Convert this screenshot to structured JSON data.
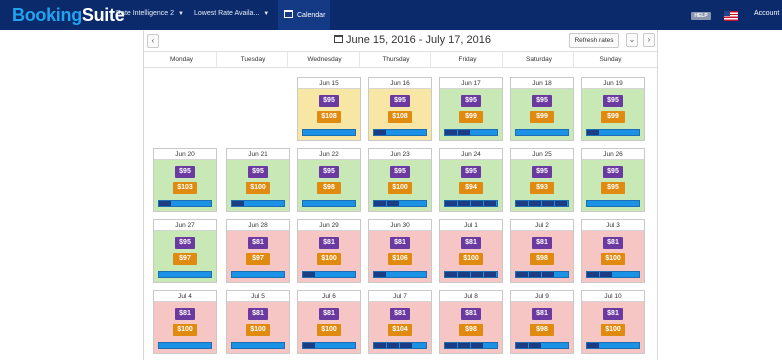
{
  "header": {
    "logo_part1": "Booking",
    "logo_part2": "Suite",
    "nav": [
      {
        "label": "Rate Intelligence 2"
      },
      {
        "label": "Lowest Rate Availa..."
      }
    ],
    "calendar_tab": "Calendar",
    "help": "HELP",
    "account": "Account"
  },
  "toolbar": {
    "prev": "‹",
    "next": "›",
    "range": "June 15, 2016 - July 17, 2016",
    "refresh": "Refresh rates",
    "dropdown": "⌄"
  },
  "weekdays": [
    "Monday",
    "Tuesday",
    "Wednesday",
    "Thursday",
    "Friday",
    "Saturday",
    "Sunday"
  ],
  "colors": {
    "yellow": "#f8e7a4",
    "green": "#c8e8b6",
    "red": "#f6c6c4",
    "purple": "#6a3aa0",
    "orange": "#e08a10",
    "bar": "#1c92e6"
  },
  "days": [
    {
      "date": "Jun 15",
      "rate": "$95",
      "compare": "$108",
      "status": "yellow",
      "level": 0
    },
    {
      "date": "Jun 16",
      "rate": "$95",
      "compare": "$108",
      "status": "yellow",
      "level": 1
    },
    {
      "date": "Jun 17",
      "rate": "$95",
      "compare": "$99",
      "status": "green",
      "level": 2
    },
    {
      "date": "Jun 18",
      "rate": "$95",
      "compare": "$99",
      "status": "green",
      "level": 0
    },
    {
      "date": "Jun 19",
      "rate": "$95",
      "compare": "$99",
      "status": "green",
      "level": 1
    },
    {
      "date": "Jun 20",
      "rate": "$95",
      "compare": "$103",
      "status": "green",
      "level": 1
    },
    {
      "date": "Jun 21",
      "rate": "$95",
      "compare": "$100",
      "status": "green",
      "level": 1
    },
    {
      "date": "Jun 22",
      "rate": "$95",
      "compare": "$98",
      "status": "green",
      "level": 0
    },
    {
      "date": "Jun 23",
      "rate": "$95",
      "compare": "$100",
      "status": "green",
      "level": 2
    },
    {
      "date": "Jun 24",
      "rate": "$95",
      "compare": "$94",
      "status": "green",
      "level": 4
    },
    {
      "date": "Jun 25",
      "rate": "$95",
      "compare": "$93",
      "status": "green",
      "level": 4
    },
    {
      "date": "Jun 26",
      "rate": "$95",
      "compare": "$95",
      "status": "green",
      "level": 0
    },
    {
      "date": "Jun 27",
      "rate": "$95",
      "compare": "$97",
      "status": "green",
      "level": 0
    },
    {
      "date": "Jun 28",
      "rate": "$81",
      "compare": "$97",
      "status": "red",
      "level": 0
    },
    {
      "date": "Jun 29",
      "rate": "$81",
      "compare": "$100",
      "status": "red",
      "level": 1
    },
    {
      "date": "Jun 30",
      "rate": "$81",
      "compare": "$106",
      "status": "red",
      "level": 1
    },
    {
      "date": "Jul 1",
      "rate": "$81",
      "compare": "$100",
      "status": "red",
      "level": 4
    },
    {
      "date": "Jul 2",
      "rate": "$81",
      "compare": "$98",
      "status": "red",
      "level": 3
    },
    {
      "date": "Jul 3",
      "rate": "$81",
      "compare": "$100",
      "status": "red",
      "level": 2
    },
    {
      "date": "Jul 4",
      "rate": "$81",
      "compare": "$100",
      "status": "red",
      "level": 0
    },
    {
      "date": "Jul 5",
      "rate": "$81",
      "compare": "$100",
      "status": "red",
      "level": 0
    },
    {
      "date": "Jul 6",
      "rate": "$81",
      "compare": "$100",
      "status": "red",
      "level": 1
    },
    {
      "date": "Jul 7",
      "rate": "$81",
      "compare": "$104",
      "status": "red",
      "level": 3
    },
    {
      "date": "Jul 8",
      "rate": "$81",
      "compare": "$98",
      "status": "red",
      "level": 3
    },
    {
      "date": "Jul 9",
      "rate": "$81",
      "compare": "$98",
      "status": "red",
      "level": 2
    },
    {
      "date": "Jul 10",
      "rate": "$81",
      "compare": "$100",
      "status": "red",
      "level": 1
    }
  ]
}
